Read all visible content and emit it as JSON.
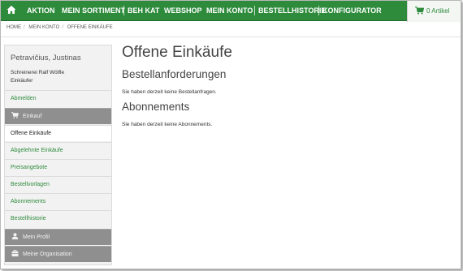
{
  "nav": {
    "items": [
      "AKTION",
      "MEIN SORTIMENT",
      "BEH KAT",
      "WEBSHOP",
      "MEIN KONTO",
      "BESTELLHISTORIE",
      "KONFIGURATOR"
    ],
    "cart_label": "0 Artikel"
  },
  "breadcrumb": [
    "HOME",
    "MEIN KONTO",
    "OFFENE EINKÄUFE"
  ],
  "sidebar": {
    "user_name": "Petravičius, Justinas",
    "company_line1": "Schreinerei Ralf Wölfle",
    "company_line2": "Einkäufer",
    "logout": "Abmelden",
    "section_purchases": "Einkauf",
    "items": [
      "Offene Einkäufe",
      "Abgelehnte Einkäufe",
      "Preisangebote",
      "Bestellvorlagen",
      "Abonnements",
      "Bestellhistorie"
    ],
    "section_profile": "Mein Profil",
    "section_org": "Meine Organisation"
  },
  "main": {
    "title": "Offene Einkäufe",
    "orders_heading": "Bestellanforderungen",
    "orders_text": "Sie haben derzeit keine Bestellanfragen.",
    "subs_heading": "Abonnements",
    "subs_text": "Sie haben derzeit keine Abonnements."
  },
  "colors": {
    "brand_green": "#2e8b3c",
    "sidebar_grey": "#8f8f8f"
  }
}
